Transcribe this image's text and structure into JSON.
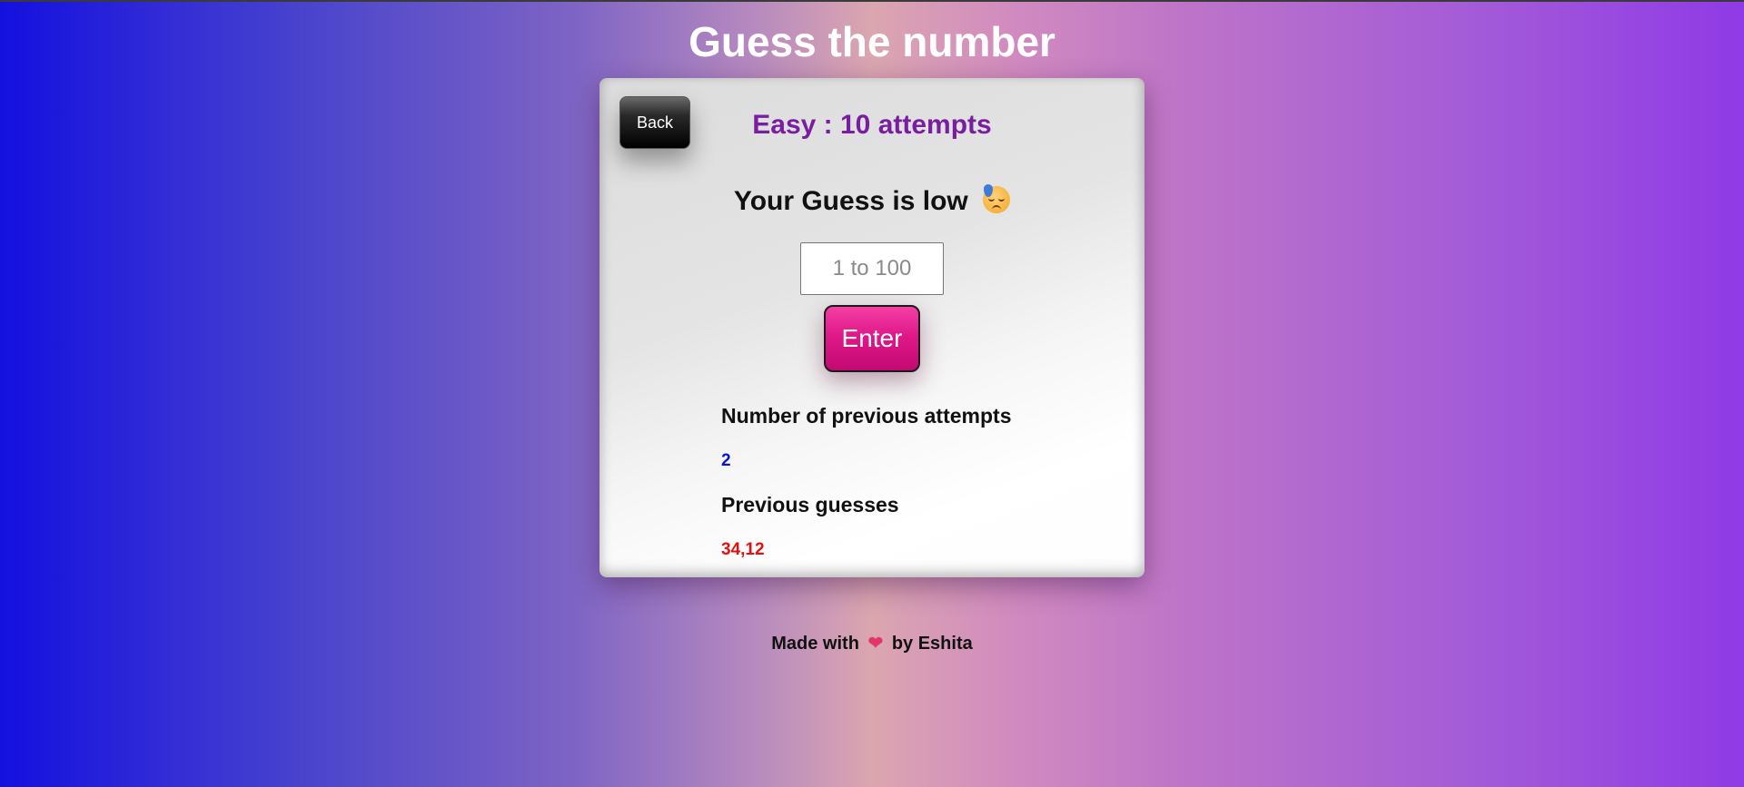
{
  "page": {
    "title": "Guess the number"
  },
  "card": {
    "back_label": "Back",
    "mode_text": "Easy : 10 attempts",
    "feedback_text": "Your Guess is low",
    "feedback_icon": "sad-sweat-face-icon",
    "input": {
      "placeholder": "1 to 100",
      "value": ""
    },
    "enter_label": "Enter",
    "attempts_label": "Number of previous attempts",
    "attempts_value": "2",
    "guesses_label": "Previous guesses",
    "guesses_value": "34,12"
  },
  "footer": {
    "prefix": "Made with",
    "icon": "heart-icon",
    "suffix": "by Eshita"
  },
  "colors": {
    "mode_text": "#7a1ea0",
    "attempts_value": "#0a14d8",
    "guesses_value": "#e31010",
    "enter_button": "#e01889"
  }
}
